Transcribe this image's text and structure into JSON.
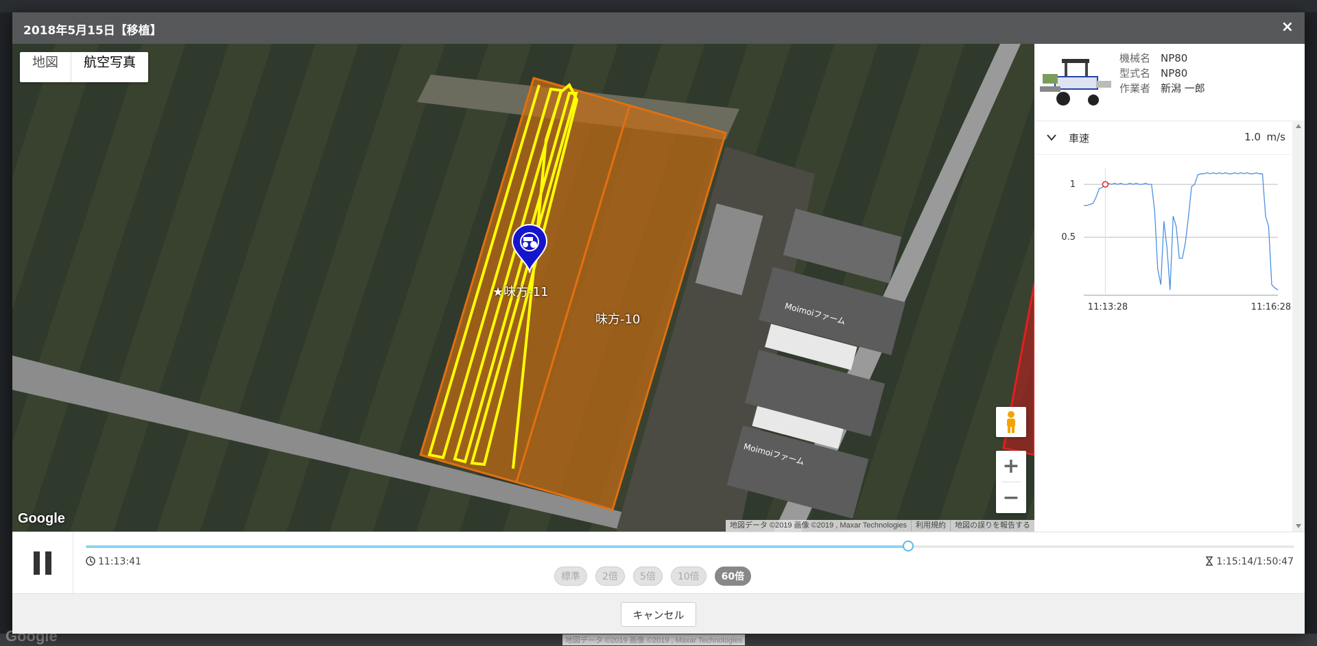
{
  "window": {
    "title": "2018年5月15日【移植】",
    "close_glyph": "×"
  },
  "map": {
    "type_buttons": [
      "地図",
      "航空写真"
    ],
    "active_type": "航空写真",
    "google_logo": "Google",
    "attribution": [
      "地図データ ©2019 画像 ©2019 , Maxar Technologies",
      "利用規約",
      "地図の誤りを報告する"
    ],
    "fields": [
      {
        "label": "★味方-11"
      },
      {
        "label": "味方-10"
      }
    ],
    "farm_labels": [
      "Moimoiファーム",
      "Moimoiファーム"
    ],
    "zoom_in": "+",
    "zoom_out": "−",
    "colors": {
      "track": "#ffff00",
      "field_outline": "#e07010",
      "marker": "#1515cc",
      "red_field": "#e02020"
    }
  },
  "machine": {
    "name_label": "機械名",
    "name": "NP80",
    "model_label": "型式名",
    "model": "NP80",
    "operator_label": "作業者",
    "operator": "新潟 一郎"
  },
  "speed_panel": {
    "label": "車速",
    "value": "1.0",
    "unit": "m/s"
  },
  "chart_data": {
    "type": "line",
    "title": "",
    "xlabel": "",
    "ylabel": "",
    "x_ticks": [
      "11:13:28",
      "11:16:28"
    ],
    "y_ticks": [
      "1",
      "0.5"
    ],
    "ylim": [
      -0.05,
      1.15
    ],
    "color": "#4a90e2",
    "values": [
      0.8,
      0.8,
      0.81,
      0.82,
      0.88,
      0.96,
      0.97,
      1.0,
      1.01,
      1.0,
      1.01,
      1.0,
      1.01,
      1.0,
      1.0,
      1.01,
      1.0,
      1.01,
      1.0,
      1.0,
      1.01,
      1.0,
      1.0,
      0.75,
      0.2,
      0.05,
      0.65,
      0.4,
      0.0,
      0.7,
      0.6,
      0.3,
      0.3,
      0.45,
      0.7,
      0.98,
      1.0,
      1.09,
      1.1,
      1.1,
      1.11,
      1.1,
      1.11,
      1.1,
      1.11,
      1.1,
      1.11,
      1.1,
      1.1,
      1.11,
      1.1,
      1.11,
      1.1,
      1.11,
      1.1,
      1.1,
      1.11,
      1.1,
      1.1,
      0.7,
      0.6,
      0.05,
      0.02,
      0.0
    ],
    "marker_index": 7
  },
  "player": {
    "current_time": "11:13:41",
    "elapsed": "1:15:14/1:50:47",
    "progress": 0.68,
    "speeds": [
      "標準",
      "2倍",
      "5倍",
      "10倍",
      "60倍"
    ],
    "active_speed": "60倍"
  },
  "footer": {
    "cancel_label": "キャンセル"
  }
}
